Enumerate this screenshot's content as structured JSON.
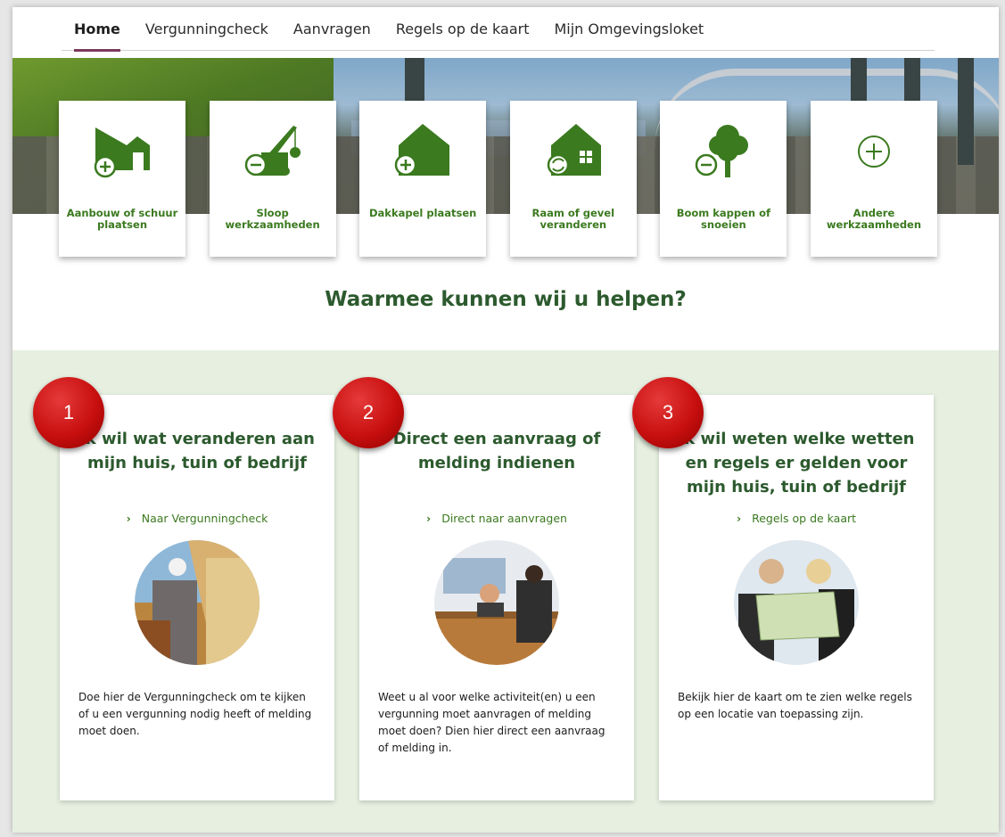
{
  "nav": {
    "items": [
      {
        "label": "Home",
        "active": true
      },
      {
        "label": "Vergunningcheck",
        "active": false
      },
      {
        "label": "Aanvragen",
        "active": false
      },
      {
        "label": "Regels op de kaart",
        "active": false
      },
      {
        "label": "Mijn Omgevingsloket",
        "active": false
      }
    ]
  },
  "tiles": [
    {
      "label": "Aanbouw of schuur plaatsen",
      "icon": "extension-house-add-icon"
    },
    {
      "label": "Sloop werkzaamheden",
      "icon": "crane-remove-icon"
    },
    {
      "label": "Dakkapel plaatsen",
      "icon": "house-dormer-add-icon"
    },
    {
      "label": "Raam of gevel veranderen",
      "icon": "house-window-change-icon"
    },
    {
      "label": "Boom kappen of snoeien",
      "icon": "tree-remove-icon"
    },
    {
      "label": "Andere werkzaamheden",
      "icon": "plus-circle-icon"
    }
  ],
  "help_title": "Waarmee kunnen wij u helpen?",
  "cards": [
    {
      "badge": "1",
      "title": "Ik wil wat veranderen aan mijn huis, tuin of bedrijf",
      "link": "Naar Vergunningcheck",
      "text": "Doe hier de Vergunningcheck om te kijken of u een vergunning nodig heeft of melding moet doen."
    },
    {
      "badge": "2",
      "title": "Direct een aanvraag of melding indienen",
      "link": "Direct naar aanvragen",
      "text": "Weet u al voor welke activiteit(en) u een vergunning moet aanvragen of melding moet doen? Dien hier direct een aanvraag of melding in."
    },
    {
      "badge": "3",
      "title": "Ik wil weten welke wetten en regels er gelden voor mijn huis, tuin of bedrijf",
      "link": "Regels op de kaart",
      "text": "Bekijk hier de kaart om te zien welke regels op een locatie van toepassing zijn."
    }
  ],
  "colors": {
    "brand_green": "#3b7a1f",
    "title_green": "#2c5a2e",
    "lower_bg": "#e6efe0",
    "active_underline": "#7b3a5a",
    "badge_red": "#c80f0f"
  }
}
